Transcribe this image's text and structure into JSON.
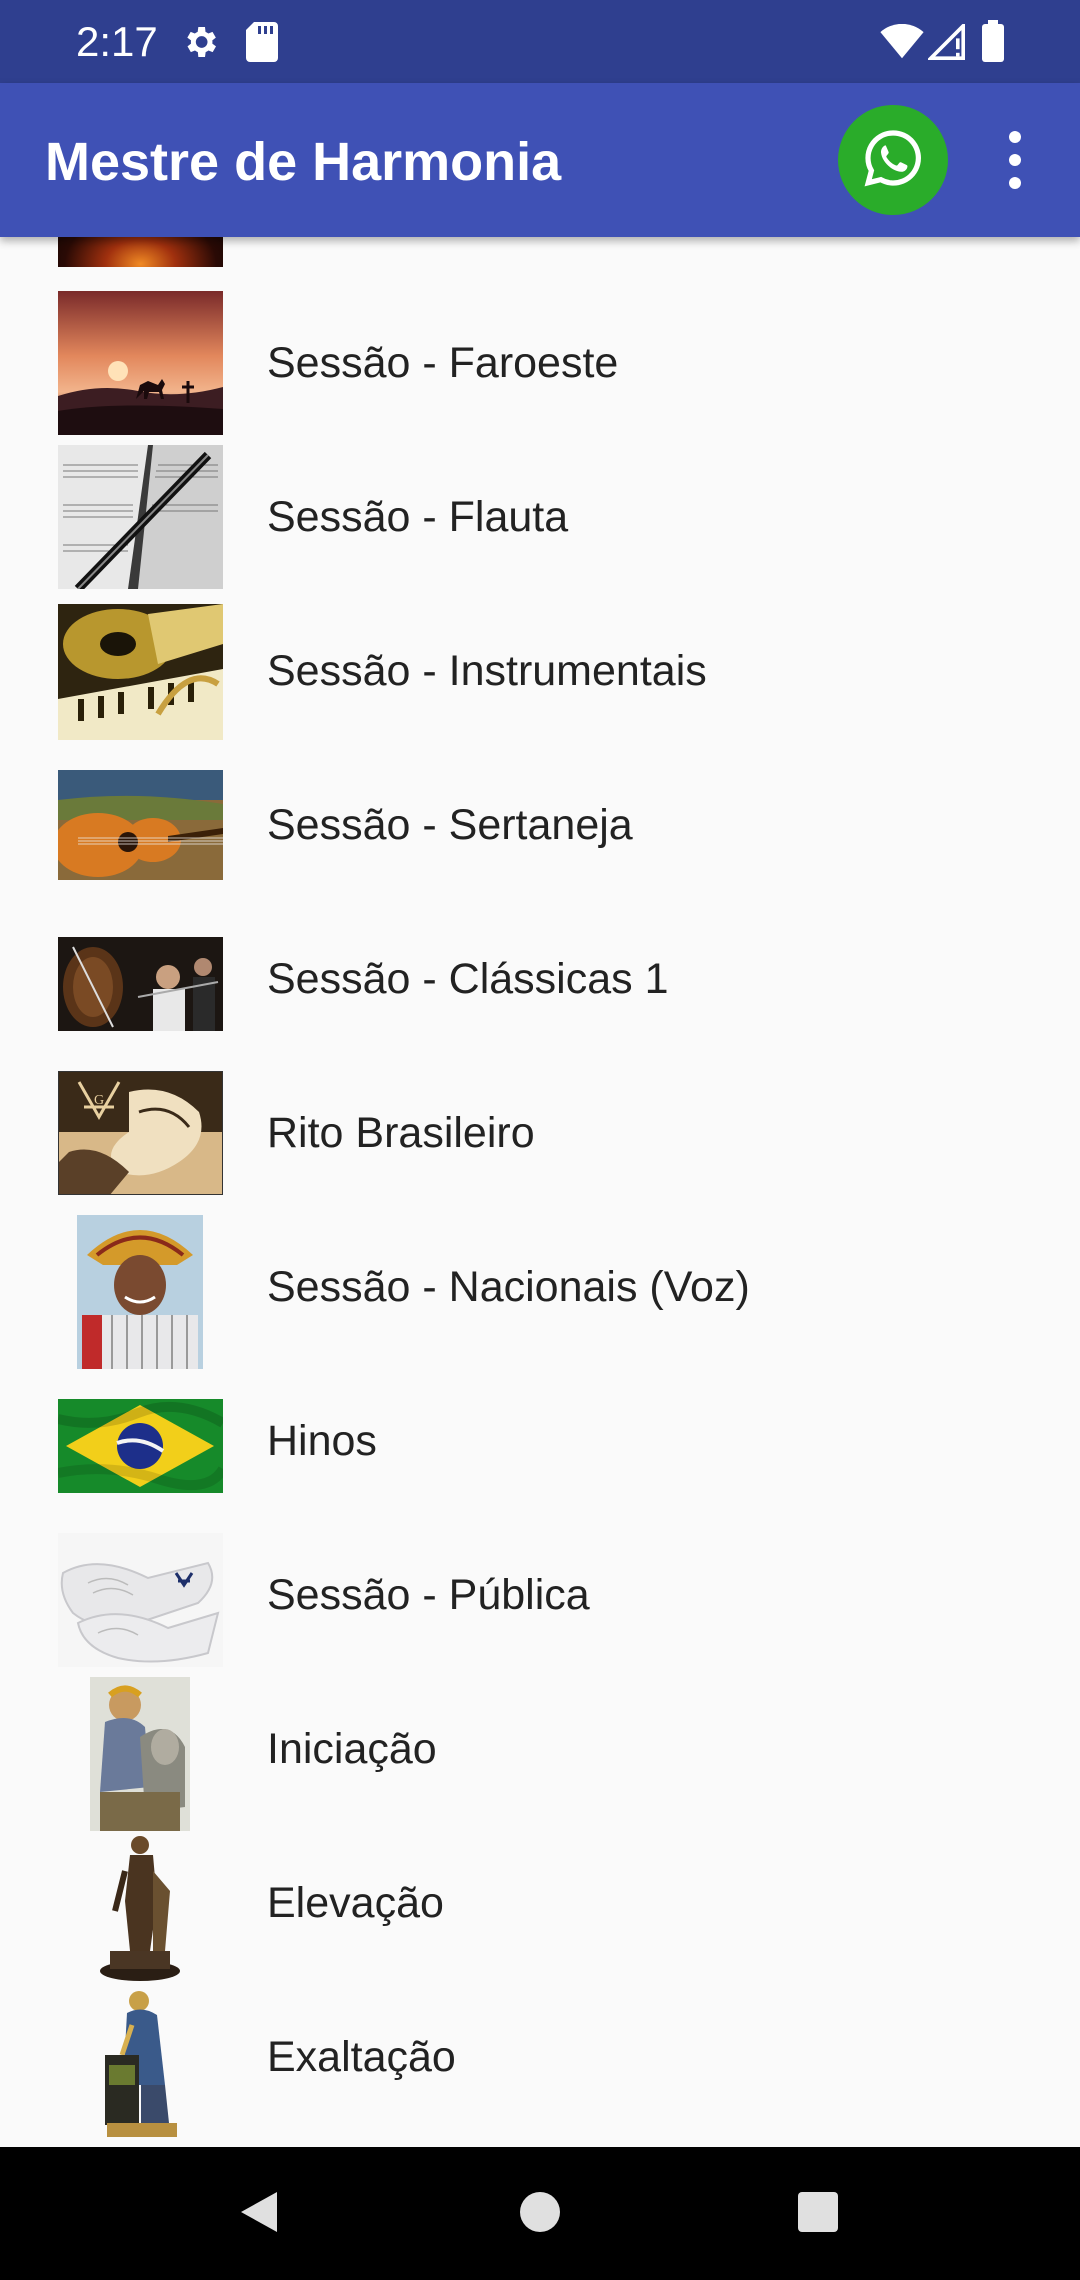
{
  "status_bar": {
    "time": "2:17",
    "left_icons": [
      "gear-icon",
      "sd-card-icon"
    ],
    "right_icons": [
      "wifi-icon",
      "signal-icon",
      "battery-icon"
    ]
  },
  "app_bar": {
    "title": "Mestre de Harmonia",
    "whatsapp_icon": "whatsapp-icon",
    "overflow_icon": "more-vert-icon",
    "bg_color": "#3f51b5",
    "whatsapp_color": "#2aac2a"
  },
  "list": {
    "items": [
      {
        "label": "",
        "thumb": "campfire-thumbnail"
      },
      {
        "label": "Sessão - Faroeste",
        "thumb": "western-sunset-thumbnail"
      },
      {
        "label": "Sessão - Flauta",
        "thumb": "flute-sheet-music-thumbnail"
      },
      {
        "label": "Sessão - Instrumentais",
        "thumb": "instruments-thumbnail"
      },
      {
        "label": "Sessão - Sertaneja",
        "thumb": "guitar-thumbnail"
      },
      {
        "label": "Sessão - Clássicas 1",
        "thumb": "orchestra-thumbnail"
      },
      {
        "label": "Rito Brasileiro",
        "thumb": "masonic-rite-thumbnail"
      },
      {
        "label": "Sessão - Nacionais (Voz)",
        "thumb": "accordion-singer-thumbnail"
      },
      {
        "label": "Hinos",
        "thumb": "brazil-flag-thumbnail"
      },
      {
        "label": "Sessão - Pública",
        "thumb": "white-gloves-thumbnail"
      },
      {
        "label": "Iniciação",
        "thumb": "initiation-statue-thumbnail"
      },
      {
        "label": "Elevação",
        "thumb": "elevation-statue-thumbnail"
      },
      {
        "label": "Exaltação",
        "thumb": "exaltation-statue-thumbnail"
      }
    ]
  },
  "nav_bar": {
    "back_icon": "back-icon",
    "home_icon": "home-icon",
    "recents_icon": "recents-icon"
  }
}
